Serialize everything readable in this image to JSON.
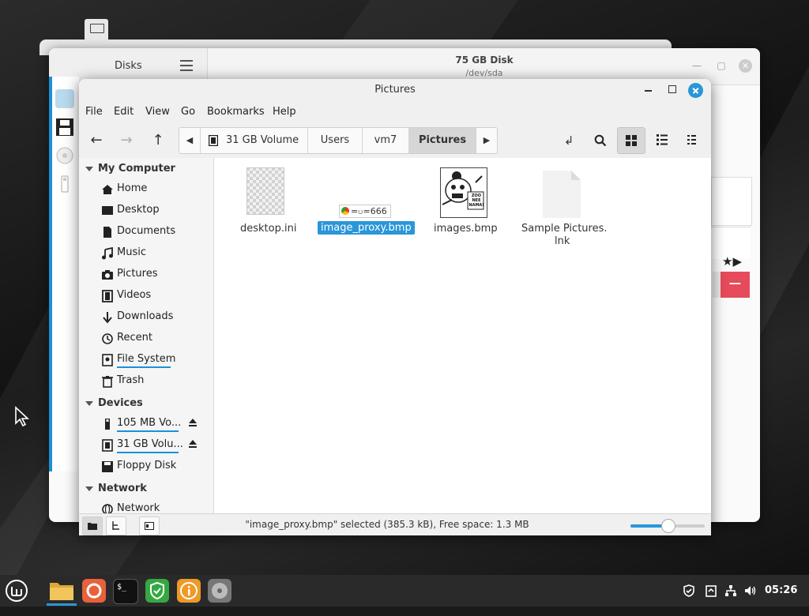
{
  "colors": {
    "accent": "#2a96d8",
    "danger": "#e54b5a",
    "taskbar": "#2a2a2a"
  },
  "disks": {
    "title": "Disks",
    "disk_title": "75 GB Disk",
    "disk_path": "/dev/sda",
    "star_controls": "★▶",
    "minus_label": "−"
  },
  "window": {
    "title": "Pictures"
  },
  "menu": [
    "File",
    "Edit",
    "View",
    "Go",
    "Bookmarks",
    "Help"
  ],
  "breadcrumb": [
    "31 GB Volume",
    "Users",
    "vm7",
    "Pictures"
  ],
  "sidebar": {
    "sections": {
      "computer": "My Computer",
      "devices": "Devices",
      "network": "Network"
    },
    "computer_items": [
      "Home",
      "Desktop",
      "Documents",
      "Music",
      "Pictures",
      "Videos",
      "Downloads",
      "Recent",
      "File System",
      "Trash"
    ],
    "device_items": [
      "105 MB Vo...",
      "31 GB Volu...",
      "Floppy Disk"
    ],
    "network_items": [
      "Network"
    ]
  },
  "files": [
    {
      "name": "desktop.ini",
      "icon": "ini-file-icon"
    },
    {
      "name": "image_proxy.bmp",
      "icon": "image-file-icon",
      "selected": true,
      "thumb_text": "=ပ=666"
    },
    {
      "name": "images.bmp",
      "icon": "image-file-icon",
      "thumb_text": "ZOO NEE NAMA!"
    },
    {
      "name": "Sample Pictures.",
      "name2": "lnk",
      "icon": "link-file-icon"
    }
  ],
  "status": {
    "text": "\"image_proxy.bmp\" selected (385.3 kB), Free space: 1.3 MB",
    "zoom_fraction": 0.5
  },
  "taskbar": {
    "clock": "05:26"
  }
}
